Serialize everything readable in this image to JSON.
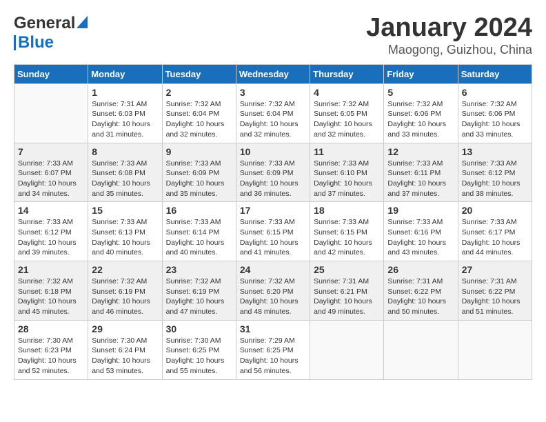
{
  "header": {
    "logo_general": "General",
    "logo_blue": "Blue",
    "month_title": "January 2024",
    "location": "Maogong, Guizhou, China"
  },
  "days_of_week": [
    "Sunday",
    "Monday",
    "Tuesday",
    "Wednesday",
    "Thursday",
    "Friday",
    "Saturday"
  ],
  "weeks": [
    [
      {
        "day": "",
        "info": ""
      },
      {
        "day": "1",
        "info": "Sunrise: 7:31 AM\nSunset: 6:03 PM\nDaylight: 10 hours\nand 31 minutes."
      },
      {
        "day": "2",
        "info": "Sunrise: 7:32 AM\nSunset: 6:04 PM\nDaylight: 10 hours\nand 32 minutes."
      },
      {
        "day": "3",
        "info": "Sunrise: 7:32 AM\nSunset: 6:04 PM\nDaylight: 10 hours\nand 32 minutes."
      },
      {
        "day": "4",
        "info": "Sunrise: 7:32 AM\nSunset: 6:05 PM\nDaylight: 10 hours\nand 32 minutes."
      },
      {
        "day": "5",
        "info": "Sunrise: 7:32 AM\nSunset: 6:06 PM\nDaylight: 10 hours\nand 33 minutes."
      },
      {
        "day": "6",
        "info": "Sunrise: 7:32 AM\nSunset: 6:06 PM\nDaylight: 10 hours\nand 33 minutes."
      }
    ],
    [
      {
        "day": "7",
        "info": "Sunrise: 7:33 AM\nSunset: 6:07 PM\nDaylight: 10 hours\nand 34 minutes."
      },
      {
        "day": "8",
        "info": "Sunrise: 7:33 AM\nSunset: 6:08 PM\nDaylight: 10 hours\nand 35 minutes."
      },
      {
        "day": "9",
        "info": "Sunrise: 7:33 AM\nSunset: 6:09 PM\nDaylight: 10 hours\nand 35 minutes."
      },
      {
        "day": "10",
        "info": "Sunrise: 7:33 AM\nSunset: 6:09 PM\nDaylight: 10 hours\nand 36 minutes."
      },
      {
        "day": "11",
        "info": "Sunrise: 7:33 AM\nSunset: 6:10 PM\nDaylight: 10 hours\nand 37 minutes."
      },
      {
        "day": "12",
        "info": "Sunrise: 7:33 AM\nSunset: 6:11 PM\nDaylight: 10 hours\nand 37 minutes."
      },
      {
        "day": "13",
        "info": "Sunrise: 7:33 AM\nSunset: 6:12 PM\nDaylight: 10 hours\nand 38 minutes."
      }
    ],
    [
      {
        "day": "14",
        "info": "Sunrise: 7:33 AM\nSunset: 6:12 PM\nDaylight: 10 hours\nand 39 minutes."
      },
      {
        "day": "15",
        "info": "Sunrise: 7:33 AM\nSunset: 6:13 PM\nDaylight: 10 hours\nand 40 minutes."
      },
      {
        "day": "16",
        "info": "Sunrise: 7:33 AM\nSunset: 6:14 PM\nDaylight: 10 hours\nand 40 minutes."
      },
      {
        "day": "17",
        "info": "Sunrise: 7:33 AM\nSunset: 6:15 PM\nDaylight: 10 hours\nand 41 minutes."
      },
      {
        "day": "18",
        "info": "Sunrise: 7:33 AM\nSunset: 6:15 PM\nDaylight: 10 hours\nand 42 minutes."
      },
      {
        "day": "19",
        "info": "Sunrise: 7:33 AM\nSunset: 6:16 PM\nDaylight: 10 hours\nand 43 minutes."
      },
      {
        "day": "20",
        "info": "Sunrise: 7:33 AM\nSunset: 6:17 PM\nDaylight: 10 hours\nand 44 minutes."
      }
    ],
    [
      {
        "day": "21",
        "info": "Sunrise: 7:32 AM\nSunset: 6:18 PM\nDaylight: 10 hours\nand 45 minutes."
      },
      {
        "day": "22",
        "info": "Sunrise: 7:32 AM\nSunset: 6:19 PM\nDaylight: 10 hours\nand 46 minutes."
      },
      {
        "day": "23",
        "info": "Sunrise: 7:32 AM\nSunset: 6:19 PM\nDaylight: 10 hours\nand 47 minutes."
      },
      {
        "day": "24",
        "info": "Sunrise: 7:32 AM\nSunset: 6:20 PM\nDaylight: 10 hours\nand 48 minutes."
      },
      {
        "day": "25",
        "info": "Sunrise: 7:31 AM\nSunset: 6:21 PM\nDaylight: 10 hours\nand 49 minutes."
      },
      {
        "day": "26",
        "info": "Sunrise: 7:31 AM\nSunset: 6:22 PM\nDaylight: 10 hours\nand 50 minutes."
      },
      {
        "day": "27",
        "info": "Sunrise: 7:31 AM\nSunset: 6:22 PM\nDaylight: 10 hours\nand 51 minutes."
      }
    ],
    [
      {
        "day": "28",
        "info": "Sunrise: 7:30 AM\nSunset: 6:23 PM\nDaylight: 10 hours\nand 52 minutes."
      },
      {
        "day": "29",
        "info": "Sunrise: 7:30 AM\nSunset: 6:24 PM\nDaylight: 10 hours\nand 53 minutes."
      },
      {
        "day": "30",
        "info": "Sunrise: 7:30 AM\nSunset: 6:25 PM\nDaylight: 10 hours\nand 55 minutes."
      },
      {
        "day": "31",
        "info": "Sunrise: 7:29 AM\nSunset: 6:25 PM\nDaylight: 10 hours\nand 56 minutes."
      },
      {
        "day": "",
        "info": ""
      },
      {
        "day": "",
        "info": ""
      },
      {
        "day": "",
        "info": ""
      }
    ]
  ]
}
